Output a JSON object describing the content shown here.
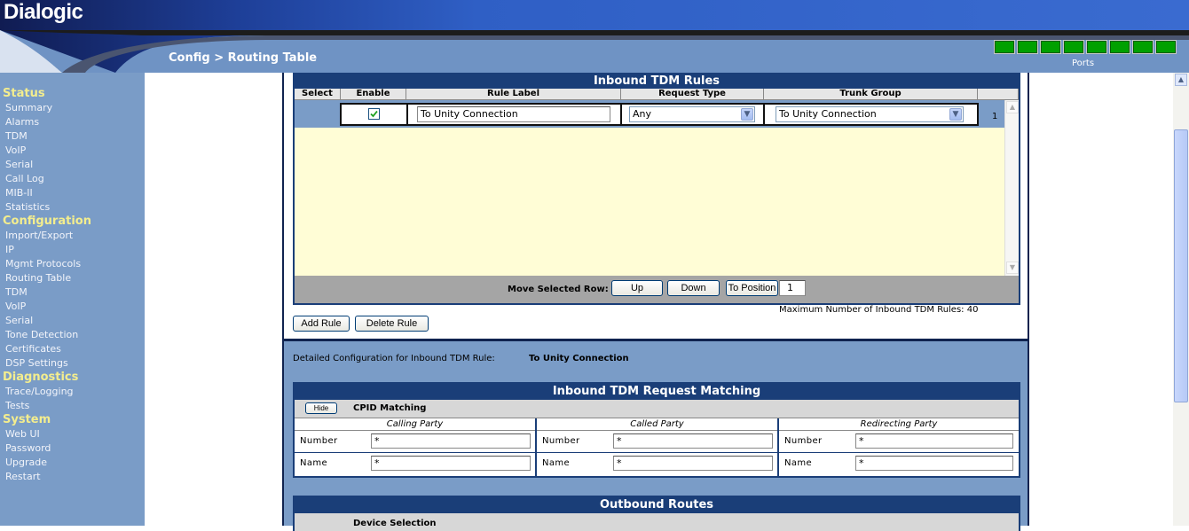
{
  "header": {
    "logo": "Dialogic",
    "breadcrumb": "Config > Routing Table",
    "ports_label": "Ports",
    "port_count": 8,
    "port_status_color": "#00a000"
  },
  "sidebar": {
    "sections": [
      {
        "title": "Status",
        "items": [
          "Summary",
          "Alarms",
          "TDM",
          "VoIP",
          "Serial",
          "Call Log",
          "MIB-II",
          "Statistics"
        ]
      },
      {
        "title": "Configuration",
        "items": [
          "Import/Export",
          "IP",
          "Mgmt Protocols",
          "Routing Table",
          "TDM",
          "VoIP",
          "Serial",
          "Tone Detection",
          "Certificates",
          "DSP Settings"
        ]
      },
      {
        "title": "Diagnostics",
        "items": [
          "Trace/Logging",
          "Tests"
        ]
      },
      {
        "title": "System",
        "items": [
          "Web UI",
          "Password",
          "Upgrade",
          "Restart"
        ]
      }
    ]
  },
  "rules": {
    "title": "Inbound TDM Rules",
    "columns": [
      "Select",
      "Enable",
      "Rule Label",
      "Request Type",
      "Trunk Group"
    ],
    "row": {
      "enabled": true,
      "label": "To Unity Connection",
      "request_type": "Any",
      "trunk_group": "To Unity Connection",
      "number": "1"
    },
    "move_label": "Move Selected Row:",
    "up": "Up",
    "down": "Down",
    "to_position": "To Position",
    "position_value": "1",
    "add_rule": "Add Rule",
    "delete_rule": "Delete Rule",
    "max_text": "Maximum Number of Inbound TDM Rules: 40"
  },
  "detail": {
    "label": "Detailed Configuration for Inbound TDM Rule:",
    "rule_name": "To Unity Connection"
  },
  "matching": {
    "title": "Inbound TDM Request Matching",
    "hide": "Hide",
    "cpid": "CPID Matching",
    "parties": [
      {
        "head": "Calling Party",
        "number_label": "Number",
        "number": "*",
        "name_label": "Name",
        "name": "*"
      },
      {
        "head": "Called Party",
        "number_label": "Number",
        "number": "*",
        "name_label": "Name",
        "name": "*"
      },
      {
        "head": "Redirecting Party",
        "number_label": "Number",
        "number": "*",
        "name_label": "Name",
        "name": "*"
      }
    ]
  },
  "outbound": {
    "title": "Outbound Routes",
    "device_selection": "Device Selection"
  }
}
